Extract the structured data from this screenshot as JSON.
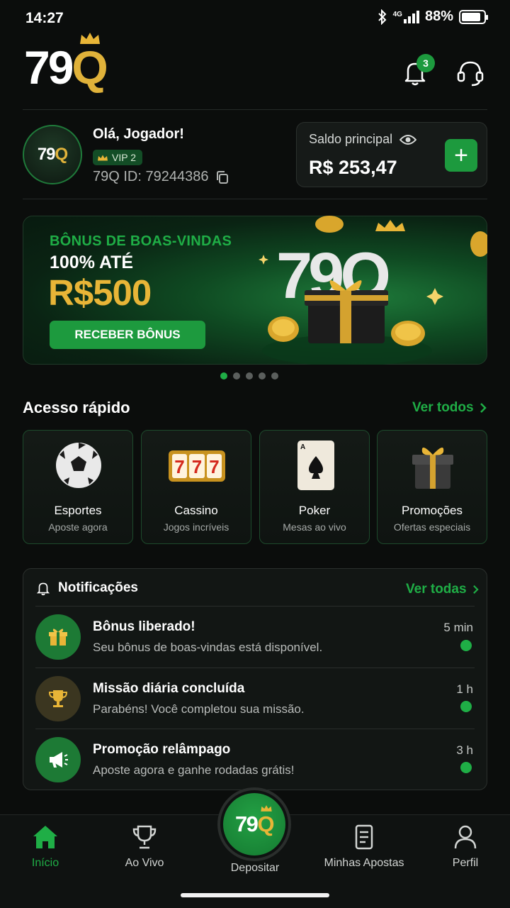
{
  "status_bar": {
    "time": "14:27",
    "network": "4G",
    "battery": "88%",
    "battery_level": 0.88
  },
  "header": {
    "logo_digits": "79",
    "logo_letter": "Q",
    "notification_count": "3"
  },
  "profile": {
    "greeting": "Olá, Jogador!",
    "vip": "VIP 2",
    "user_id": "79Q ID: 79244386",
    "avatar_digits": "79",
    "avatar_letter": "Q"
  },
  "balance": {
    "label": "Saldo principal",
    "value": "R$ 253,47",
    "add_label": "+"
  },
  "banner": {
    "subtitle": "BÔNUS DE BOAS-VINDAS",
    "title": "100% ATÉ",
    "amount": "R$500",
    "button": "RECEBER BÔNUS",
    "art_text": "79Q",
    "slides": 5,
    "active_slide": 0
  },
  "quick_access": {
    "title": "Acesso rápido",
    "link": "Ver todos",
    "items": [
      {
        "title": "Esportes",
        "subtitle": "Aposte agora",
        "icon": "soccer-ball-icon"
      },
      {
        "title": "Cassino",
        "subtitle": "Jogos incríveis",
        "icon": "slot-machine-icon"
      },
      {
        "title": "Poker",
        "subtitle": "Mesas ao vivo",
        "icon": "playing-card-icon"
      },
      {
        "title": "Promoções",
        "subtitle": "Ofertas especiais",
        "icon": "gift-box-icon"
      }
    ]
  },
  "notifications": {
    "title": "Notificações",
    "link": "Ver todas",
    "items": [
      {
        "title": "Bônus liberado!",
        "desc": "Seu bônus de boas-vindas está disponível.",
        "time": "5 min",
        "icon": "gift-icon",
        "color": "#1d7a35"
      },
      {
        "title": "Missão diária concluída",
        "desc": "Parabéns! Você completou sua missão.",
        "time": "1 h",
        "icon": "trophy-icon",
        "color": "#3b3620"
      },
      {
        "title": "Promoção relâmpago",
        "desc": "Aposte agora e ganhe rodadas grátis!",
        "time": "3 h",
        "icon": "megaphone-icon",
        "color": "#1d7a35"
      }
    ]
  },
  "bottom_nav": {
    "items": [
      {
        "label": "Início",
        "icon": "home-icon",
        "active": true
      },
      {
        "label": "Ao Vivo",
        "icon": "trophy-icon"
      },
      {
        "label": "Minhas Apostas",
        "icon": "receipt-icon"
      },
      {
        "label": "Perfil",
        "icon": "user-icon"
      }
    ],
    "center_label": "Depositar",
    "center_digits": "79",
    "center_letter": "Q"
  },
  "colors": {
    "accent": "#1fae46",
    "gold": "#e8b537",
    "background": "#0b0d0c"
  }
}
